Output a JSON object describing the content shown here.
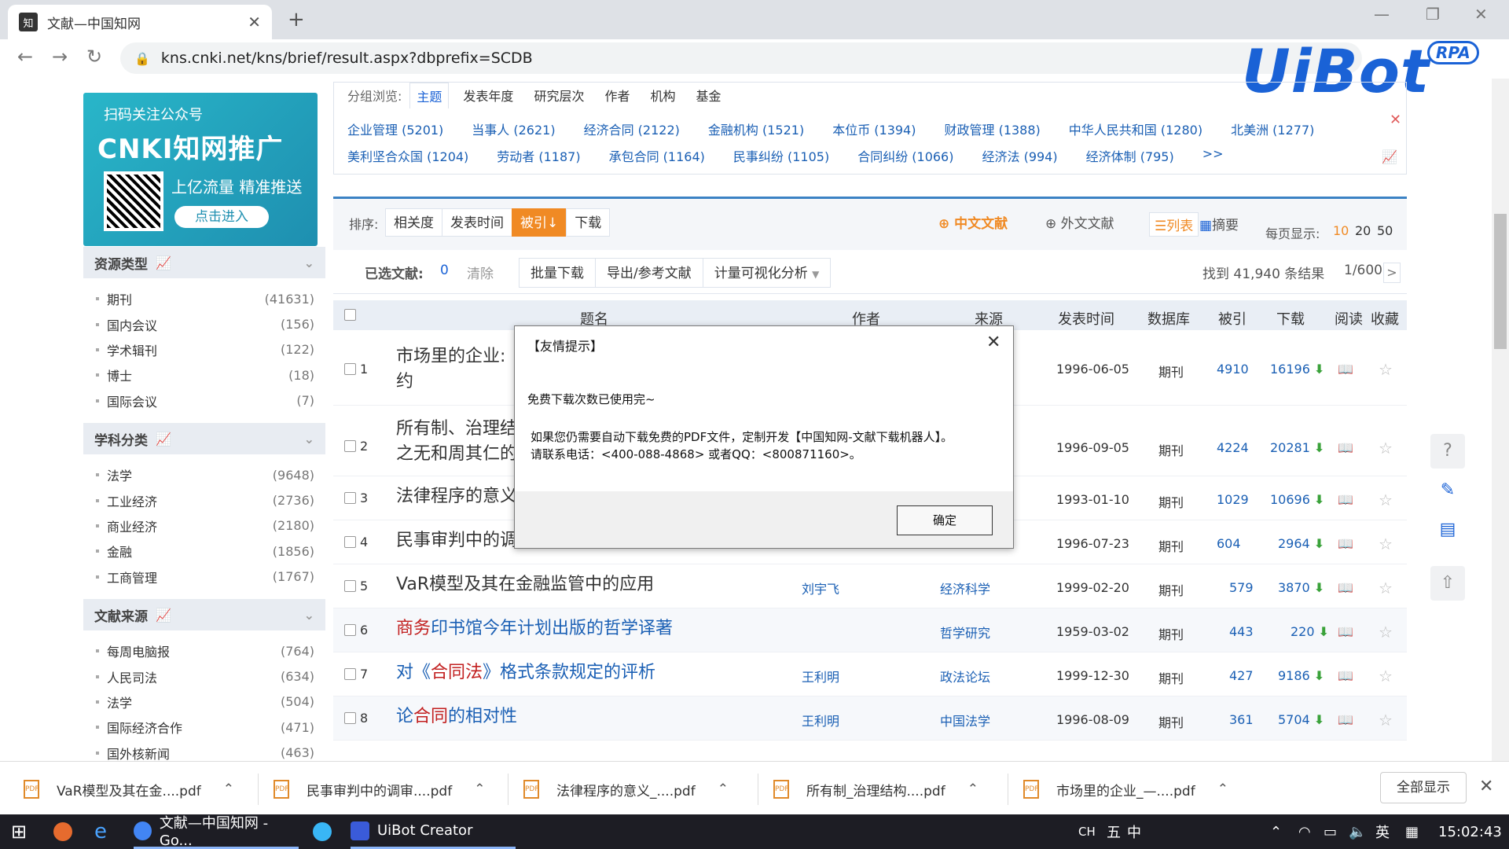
{
  "browser": {
    "tab_title": "文献—中国知网",
    "url": "kns.cnki.net/kns/brief/result.aspx?dbprefix=SCDB",
    "brand": "UiBot",
    "brand_badge": "RPA"
  },
  "banner": {
    "line1": "扫码关注公众号",
    "line2": "CNKI知网推广",
    "line3": "上亿流量 精准推送",
    "button": "点击进入"
  },
  "facets": [
    {
      "title": "资源类型",
      "items": [
        {
          "name": "期刊",
          "count": "(41631)"
        },
        {
          "name": "国内会议",
          "count": "(156)"
        },
        {
          "name": "学术辑刊",
          "count": "(122)"
        },
        {
          "name": "博士",
          "count": "(18)"
        },
        {
          "name": "国际会议",
          "count": "(7)"
        }
      ]
    },
    {
      "title": "学科分类",
      "items": [
        {
          "name": "法学",
          "count": "(9648)"
        },
        {
          "name": "工业经济",
          "count": "(2736)"
        },
        {
          "name": "商业经济",
          "count": "(2180)"
        },
        {
          "name": "金融",
          "count": "(1856)"
        },
        {
          "name": "工商管理",
          "count": "(1767)"
        }
      ]
    },
    {
      "title": "文献来源",
      "items": [
        {
          "name": "每周电脑报",
          "count": "(764)"
        },
        {
          "name": "人民司法",
          "count": "(634)"
        },
        {
          "name": "法学",
          "count": "(504)"
        },
        {
          "name": "国际经济合作",
          "count": "(471)"
        },
        {
          "name": "国外核新闻",
          "count": "(463)"
        }
      ]
    }
  ],
  "group": {
    "label": "分组浏览:",
    "tabs": [
      "主题",
      "发表年度",
      "研究层次",
      "作者",
      "机构",
      "基金"
    ],
    "row1": [
      "企业管理 (5201)",
      "当事人 (2621)",
      "经济合同 (2122)",
      "金融机构 (1521)",
      "本位币 (1394)",
      "财政管理 (1388)",
      "中华人民共和国 (1280)",
      "北美洲 (1277)"
    ],
    "row2": [
      "美利坚合众国 (1204)",
      "劳动者 (1187)",
      "承包合同 (1164)",
      "民事纠纷 (1105)",
      "合同纠纷 (1066)",
      "经济法 (994)",
      "经济体制 (795)"
    ],
    "more": ">>"
  },
  "sort": {
    "label": "排序:",
    "buttons": [
      "相关度",
      "发表时间",
      "被引↓",
      "下载"
    ],
    "cn_lit": "中文文献",
    "en_lit": "外文文献",
    "view_list": "列表",
    "view_abs": "摘要",
    "per_page_label": "每页显示:",
    "per_page": [
      "10",
      "20",
      "50"
    ]
  },
  "selection": {
    "label": "已选文献:",
    "count": "0",
    "clear": "清除",
    "buttons": [
      "批量下载",
      "导出/参考文献",
      "计量可视化分析"
    ],
    "found": "找到 41,940 条结果",
    "page": "1/600",
    "next": ">"
  },
  "table": {
    "headers": [
      "题名",
      "作者",
      "来源",
      "发表时间",
      "数据库",
      "被引",
      "下载",
      "阅读",
      "收藏"
    ],
    "rows": [
      {
        "n": "1",
        "title_a": "市场里的企业:",
        "title_b": "约",
        "author": "",
        "source": "",
        "date": "1996-06-05",
        "db": "期刊",
        "cited": "4910",
        "dl": "16196"
      },
      {
        "n": "2",
        "title_a": "所有制、治理结",
        "title_b": "之无和周其仁的",
        "author": "",
        "source": "",
        "date": "1996-09-05",
        "db": "期刊",
        "cited": "4224",
        "dl": "20281"
      },
      {
        "n": "3",
        "title_a": "法律程序的意义",
        "title_b": "",
        "author": "",
        "source": "",
        "date": "1993-01-10",
        "db": "期刊",
        "cited": "1029",
        "dl": "10696"
      },
      {
        "n": "4",
        "title_a": "民事审判中的调",
        "title_b": "",
        "author": "",
        "source": "",
        "date": "1996-07-23",
        "db": "期刊",
        "cited": "604",
        "dl": "2964"
      },
      {
        "n": "5",
        "title_a": "VaR模型及其在金融监管中的应用",
        "title_b": "",
        "author": "刘宇飞",
        "source": "经济科学",
        "date": "1999-02-20",
        "db": "期刊",
        "cited": "579",
        "dl": "3870"
      },
      {
        "n": "6",
        "title_hl": "商务",
        "title_rest": "印书馆今年计划出版的哲学译著",
        "author": "",
        "source": "哲学研究",
        "date": "1959-03-02",
        "db": "期刊",
        "cited": "443",
        "dl": "220"
      },
      {
        "n": "7",
        "title_pre": "对《",
        "title_hl": "合同法",
        "title_rest": "》格式条款规定的评析",
        "author": "王利明",
        "source": "政法论坛",
        "date": "1999-12-30",
        "db": "期刊",
        "cited": "427",
        "dl": "9186"
      },
      {
        "n": "8",
        "title_pre": "论",
        "title_hl": "合同",
        "title_rest": "的相对性",
        "author": "王利明",
        "source": "中国法学",
        "date": "1996-08-09",
        "db": "期刊",
        "cited": "361",
        "dl": "5704"
      }
    ]
  },
  "dialog": {
    "title": "【友情提示】",
    "line1": "免费下载次数已使用完~",
    "line2": "如果您仍需要自动下载免费的PDF文件，定制开发【中国知网-文献下载机器人】。",
    "line3": "请联系电话：<400-088-4868> 或者QQ：<800871160>。",
    "ok": "确定"
  },
  "downloads": [
    "VaR模型及其在金....pdf",
    "民事审判中的调审....pdf",
    "法律程序的意义_....pdf",
    "所有制_治理结构....pdf",
    "市场里的企业_—....pdf"
  ],
  "downloads_showall": "全部显示",
  "taskbar": {
    "chrome": "文献—中国知网 - Go...",
    "uibot": "UiBot Creator",
    "tray": [
      "CH",
      "英"
    ],
    "time": "15:02:43"
  },
  "colors": {
    "accent": "#1a62d6",
    "sort_active": "#f08a24",
    "highlight": "#c21f1f"
  }
}
